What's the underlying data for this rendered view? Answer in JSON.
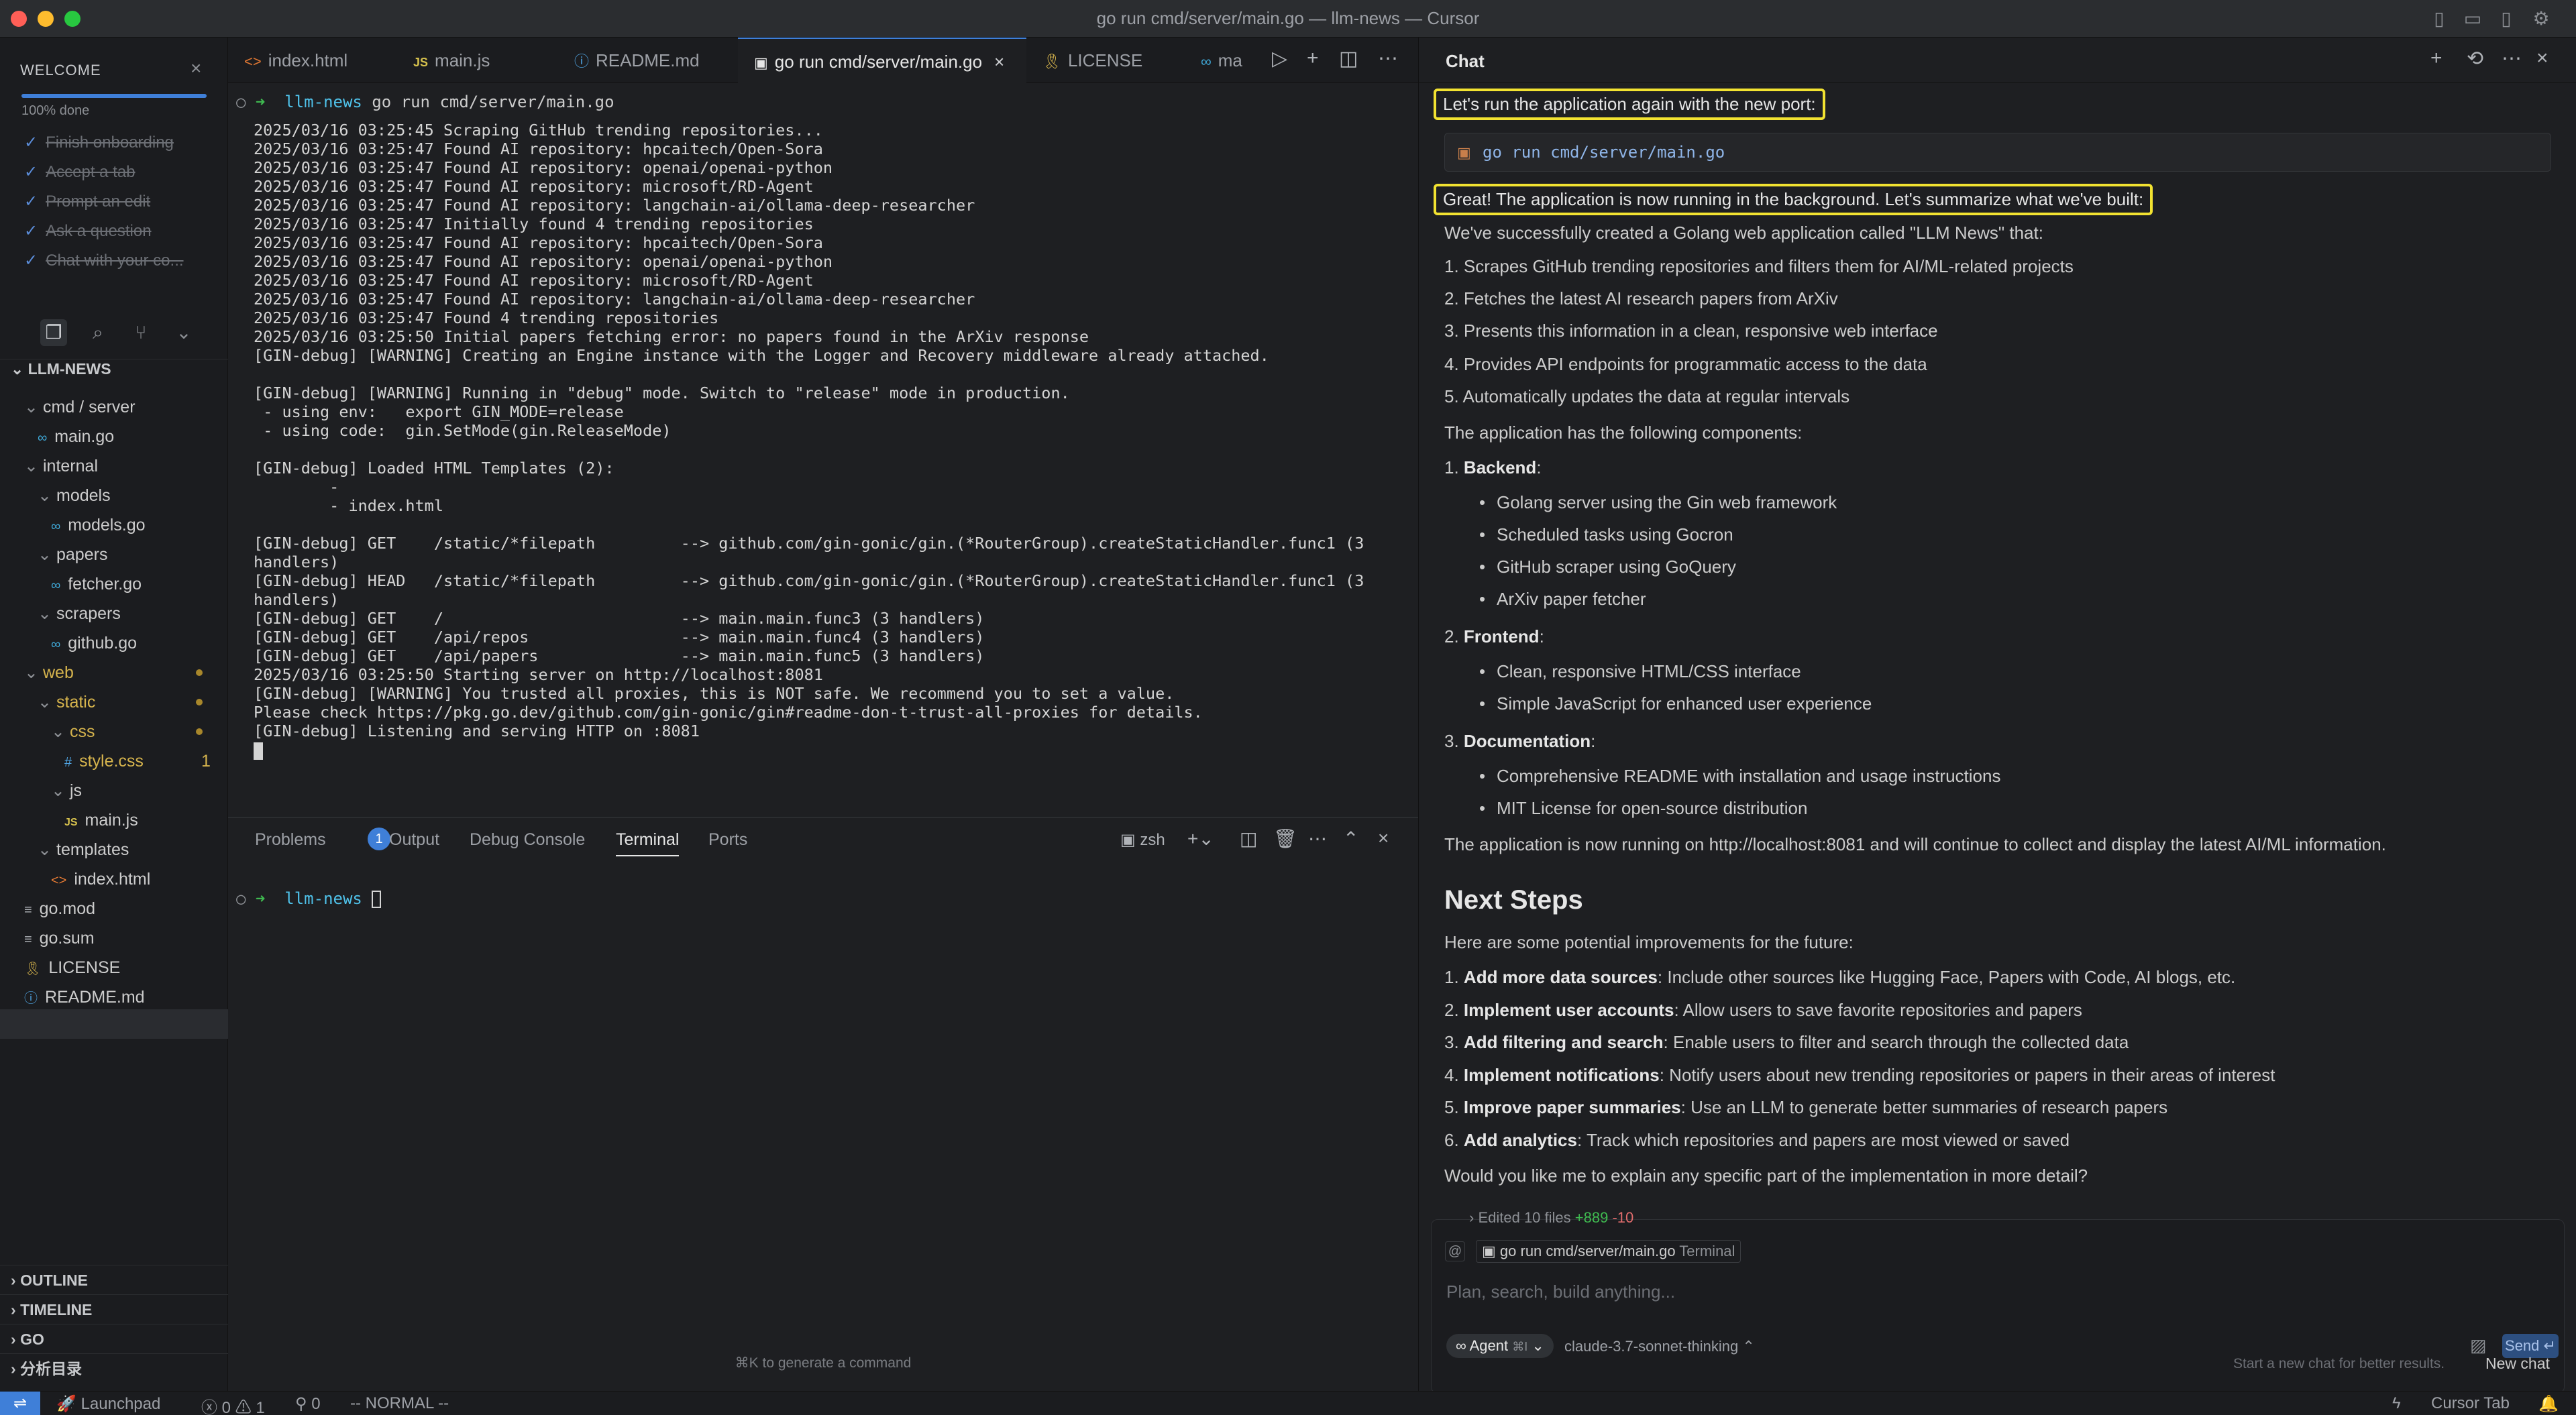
{
  "window": {
    "title": "go run cmd/server/main.go — llm-news — Cursor"
  },
  "welcome": {
    "title": "WELCOME",
    "progress_label": "100% done",
    "progress_fraction": 1.0,
    "items": [
      "Finish onboarding",
      "Accept a tab",
      "Prompt an edit",
      "Ask a question",
      "Chat with your co..."
    ]
  },
  "explorer": {
    "root": "LLM-NEWS",
    "tree": [
      {
        "label": "cmd / server",
        "kind": "folder",
        "depth": 1
      },
      {
        "label": "main.go",
        "kind": "go",
        "depth": 2
      },
      {
        "label": "internal",
        "kind": "folder",
        "depth": 1
      },
      {
        "label": "models",
        "kind": "folder",
        "depth": 2
      },
      {
        "label": "models.go",
        "kind": "go",
        "depth": 3
      },
      {
        "label": "papers",
        "kind": "folder",
        "depth": 2
      },
      {
        "label": "fetcher.go",
        "kind": "go",
        "depth": 3
      },
      {
        "label": "scrapers",
        "kind": "folder",
        "depth": 2
      },
      {
        "label": "github.go",
        "kind": "go",
        "depth": 3
      },
      {
        "label": "web",
        "kind": "folder",
        "depth": 1
      },
      {
        "label": "static",
        "kind": "folder",
        "depth": 2
      },
      {
        "label": "css",
        "kind": "folder",
        "depth": 3
      },
      {
        "label": "style.css",
        "kind": "css",
        "depth": 4,
        "badge": "1"
      },
      {
        "label": "js",
        "kind": "folder",
        "depth": 3
      },
      {
        "label": "main.js",
        "kind": "js",
        "depth": 4
      },
      {
        "label": "templates",
        "kind": "folder",
        "depth": 2
      },
      {
        "label": "index.html",
        "kind": "html",
        "depth": 3
      },
      {
        "label": "go.mod",
        "kind": "file",
        "depth": 1
      },
      {
        "label": "go.sum",
        "kind": "file",
        "depth": 1
      },
      {
        "label": "LICENSE",
        "kind": "license",
        "depth": 1
      },
      {
        "label": "README.md",
        "kind": "info",
        "depth": 1
      }
    ],
    "sections": [
      "OUTLINE",
      "TIMELINE",
      "GO",
      "分析目录"
    ]
  },
  "tabs": [
    {
      "label": "index.html",
      "icon": "<>"
    },
    {
      "label": "main.js",
      "icon": "JS"
    },
    {
      "label": "README.md",
      "icon": "ⓘ"
    },
    {
      "label": "go run cmd/server/main.go",
      "icon": "▣",
      "active": true
    },
    {
      "label": "LICENSE",
      "icon": "🎗"
    },
    {
      "label": "ma",
      "icon": "∞"
    }
  ],
  "terminal": {
    "prompt_dir": "llm-news",
    "command": "go run cmd/server/main.go",
    "lines": [
      "2025/03/16 03:25:45 Scraping GitHub trending repositories...",
      "2025/03/16 03:25:47 Found AI repository: hpcaitech/Open-Sora",
      "2025/03/16 03:25:47 Found AI repository: openai/openai-python",
      "2025/03/16 03:25:47 Found AI repository: microsoft/RD-Agent",
      "2025/03/16 03:25:47 Found AI repository: langchain-ai/ollama-deep-researcher",
      "2025/03/16 03:25:47 Initially found 4 trending repositories",
      "2025/03/16 03:25:47 Found AI repository: hpcaitech/Open-Sora",
      "2025/03/16 03:25:47 Found AI repository: openai/openai-python",
      "2025/03/16 03:25:47 Found AI repository: microsoft/RD-Agent",
      "2025/03/16 03:25:47 Found AI repository: langchain-ai/ollama-deep-researcher",
      "2025/03/16 03:25:47 Found 4 trending repositories",
      "2025/03/16 03:25:50 Initial papers fetching error: no papers found in the ArXiv response",
      "[GIN-debug] [WARNING] Creating an Engine instance with the Logger and Recovery middleware already attached.",
      "",
      "[GIN-debug] [WARNING] Running in \"debug\" mode. Switch to \"release\" mode in production.",
      " - using env:   export GIN_MODE=release",
      " - using code:  gin.SetMode(gin.ReleaseMode)",
      "",
      "[GIN-debug] Loaded HTML Templates (2):",
      "        -",
      "        - index.html",
      "",
      "[GIN-debug] GET    /static/*filepath         --> github.com/gin-gonic/gin.(*RouterGroup).createStaticHandler.func1 (3",
      "handlers)",
      "[GIN-debug] HEAD   /static/*filepath         --> github.com/gin-gonic/gin.(*RouterGroup).createStaticHandler.func1 (3",
      "handlers)",
      "[GIN-debug] GET    /                         --> main.main.func3 (3 handlers)",
      "[GIN-debug] GET    /api/repos                --> main.main.func4 (3 handlers)",
      "[GIN-debug] GET    /api/papers               --> main.main.func5 (3 handlers)",
      "2025/03/16 03:25:50 Starting server on http://localhost:8081",
      "[GIN-debug] [WARNING] You trusted all proxies, this is NOT safe. We recommend you to set a value.",
      "Please check https://pkg.go.dev/github.com/gin-gonic/gin#readme-don-t-trust-all-proxies for details.",
      "[GIN-debug] Listening and serving HTTP on :8081"
    ]
  },
  "panel": {
    "tabs": [
      "Problems",
      "Output",
      "Debug Console",
      "Terminal",
      "Ports"
    ],
    "problems_count": "1",
    "shell_label": "zsh",
    "prompt_dir": "llm-news",
    "hint": "⌘K to generate a command"
  },
  "chat": {
    "title": "Chat",
    "highlight_1": "Let's run the application again with the new port:",
    "code": "go run cmd/server/main.go",
    "highlight_2": "Great! The application is now running in the background. Let's summarize what we've built:",
    "intro": "We've successfully created a Golang web application called \"LLM News\" that:",
    "features": [
      "1. Scrapes GitHub trending repositories and filters them for AI/ML-related projects",
      "2. Fetches the latest AI research papers from ArXiv",
      "3. Presents this information in a clean, responsive web interface",
      "4. Provides API endpoints for programmatic access to the data",
      "5. Automatically updates the data at regular intervals"
    ],
    "components_intro": "The application has the following components:",
    "backend_label": "Backend",
    "backend_items": [
      "Golang server using the Gin web framework",
      "Scheduled tasks using Gocron",
      "GitHub scraper using GoQuery",
      "ArXiv paper fetcher"
    ],
    "frontend_label": "Frontend",
    "frontend_items": [
      "Clean, responsive HTML/CSS interface",
      "Simple JavaScript for enhanced user experience"
    ],
    "docs_label": "Documentation",
    "docs_items": [
      "Comprehensive README with installation and usage instructions",
      "MIT License for open-source distribution"
    ],
    "running": "The application is now running on http://localhost:8081 and will continue to collect and display the latest AI/ML information.",
    "next_steps_title": "Next Steps",
    "next_intro": "Here are some potential improvements for the future:",
    "next_items": [
      {
        "n": "1.",
        "b": "Add more data sources",
        "t": ": Include other sources like Hugging Face, Papers with Code, AI blogs, etc."
      },
      {
        "n": "2.",
        "b": "Implement user accounts",
        "t": ": Allow users to save favorite repositories and papers"
      },
      {
        "n": "3.",
        "b": "Add filtering and search",
        "t": ": Enable users to filter and search through the collected data"
      },
      {
        "n": "4.",
        "b": "Implement notifications",
        "t": ": Notify users about new trending repositories or papers in their areas of interest"
      },
      {
        "n": "5.",
        "b": "Improve paper summaries",
        "t": ": Use an LLM to generate better summaries of research papers"
      },
      {
        "n": "6.",
        "b": "Add analytics",
        "t": ": Track which repositories and papers are most viewed or saved"
      }
    ],
    "question": "Would you like me to explain any specific part of the implementation in more detail?",
    "edited_label": "Edited 10 files",
    "edited_add": "+889",
    "edited_del": "-10",
    "context_chip": "go run cmd/server/main.go",
    "context_chip_sub": "Terminal",
    "input_placeholder": "Plan, search, build anything...",
    "agent_label": "Agent",
    "agent_shortcut": "⌘I",
    "model": "claude-3.7-sonnet-thinking",
    "send_label": "Send",
    "new_chat_hint": "Start a new chat for better results.",
    "new_chat_label": "New chat"
  },
  "statusbar": {
    "launchpad": "Launchpad",
    "errors": "0",
    "warnings": "1",
    "ports": "0",
    "mode": "-- NORMAL --",
    "cursor_tab": "Cursor Tab"
  }
}
